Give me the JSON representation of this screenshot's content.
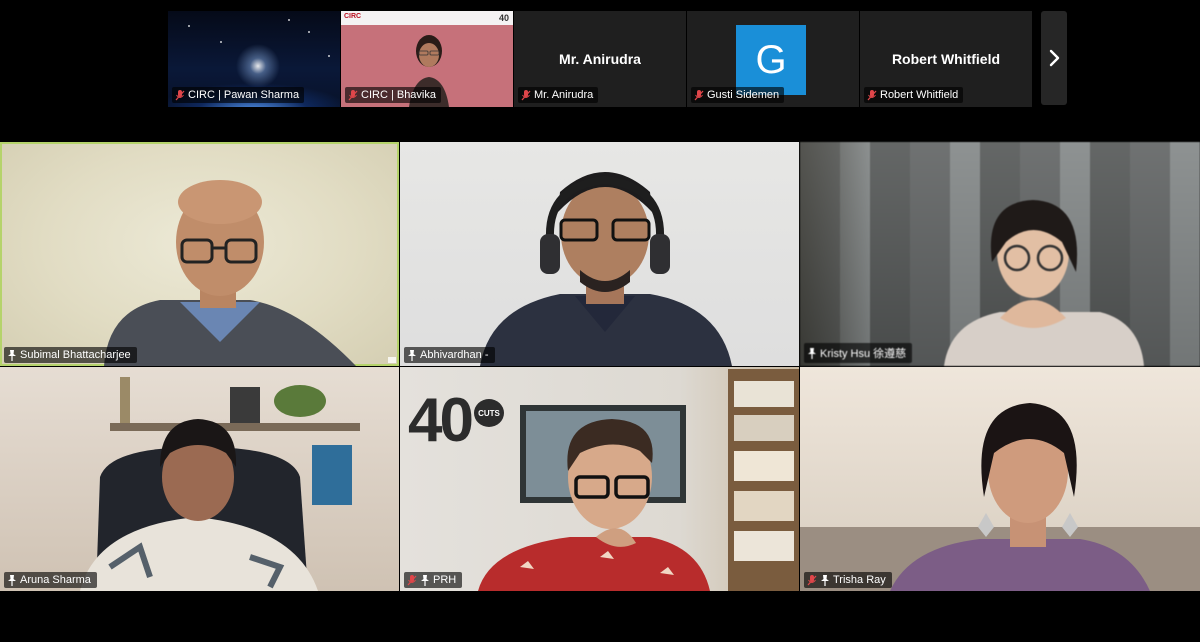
{
  "filmstrip": {
    "tiles": [
      {
        "label": "CIRC | Pawan Sharma",
        "muted": true
      },
      {
        "label": "CIRC | Bhavika",
        "muted": true
      },
      {
        "label": "Mr. Anirudra",
        "center_name": "Mr. Anirudra",
        "muted": true
      },
      {
        "label": "Gusti Sidemen",
        "avatar_letter": "G",
        "muted": true
      },
      {
        "label": "Robert Whitfield",
        "center_name": "Robert Whitfield",
        "muted": true
      }
    ],
    "next_icon": "chevron-right-icon"
  },
  "grid": {
    "tiles": [
      {
        "name": "Subimal Bhattacharjee",
        "active": true,
        "pinned": true,
        "muted": false
      },
      {
        "name": "Abhivardhan -",
        "pinned": true,
        "muted": false
      },
      {
        "name": "Kristy Hsu 徐遵慈",
        "pinned": true,
        "muted": false
      },
      {
        "name": "Aruna Sharma",
        "pinned": true,
        "muted": false
      },
      {
        "name": "PRH",
        "pinned": true,
        "muted": true
      },
      {
        "name": "Trisha Ray",
        "pinned": true,
        "muted": true
      }
    ],
    "prh_background_logo": "40",
    "prh_logo_badge": "CUTS"
  },
  "colors": {
    "background": "#000000",
    "active_speaker_border": "#b5d36b",
    "muted_icon": "#e0464a",
    "avatar_blue": "#1a8fd8"
  },
  "strip_logos": {
    "circ": "CIRC",
    "forty": "40"
  }
}
